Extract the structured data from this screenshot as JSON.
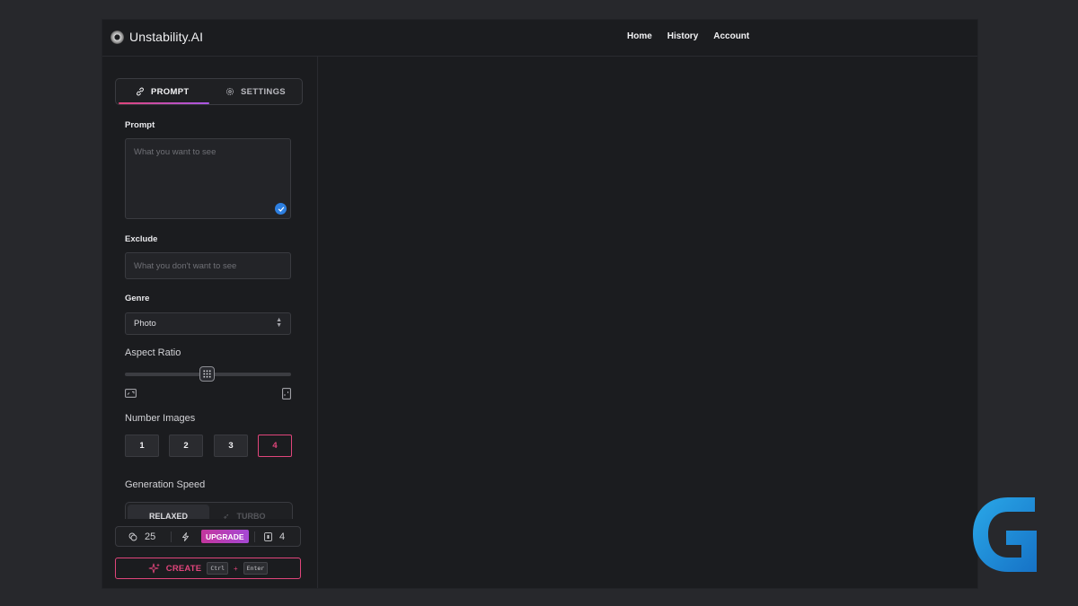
{
  "brand": {
    "name": "Unstability.AI"
  },
  "nav": {
    "home": "Home",
    "history": "History",
    "account": "Account"
  },
  "tabs": {
    "prompt": "PROMPT",
    "settings": "SETTINGS"
  },
  "form": {
    "prompt_label": "Prompt",
    "prompt_placeholder": "What you want to see",
    "exclude_label": "Exclude",
    "exclude_placeholder": "What you don't want to see",
    "genre_label": "Genre",
    "genre_value": "Photo",
    "aspect_label": "Aspect Ratio",
    "aspect_value": 0.5,
    "number_label": "Number Images",
    "number_options": [
      "1",
      "2",
      "3",
      "4"
    ],
    "number_selected": "4",
    "speed_label": "Generation Speed",
    "speed_options": {
      "relaxed": "RELAXED",
      "turbo": "TURBO"
    },
    "speed_selected": "RELAXED"
  },
  "stats": {
    "credits": "25",
    "upgrade": "UPGRADE",
    "images": "4"
  },
  "create": {
    "label": "CREATE",
    "key1": "Ctrl",
    "plus": "+",
    "key2": "Enter"
  },
  "colors": {
    "accent": "#e0457b",
    "upgrade": "#b53fb9",
    "check": "#2d7fe0",
    "background": "#1b1c1f"
  },
  "icons": [
    "link-icon",
    "gear-icon",
    "check-icon",
    "select-arrows-icon",
    "grid-icon",
    "landscape-icon",
    "portrait-icon",
    "coins-icon",
    "bolt-icon",
    "image-count-icon",
    "sparkle-icon",
    "g-logo-icon"
  ]
}
